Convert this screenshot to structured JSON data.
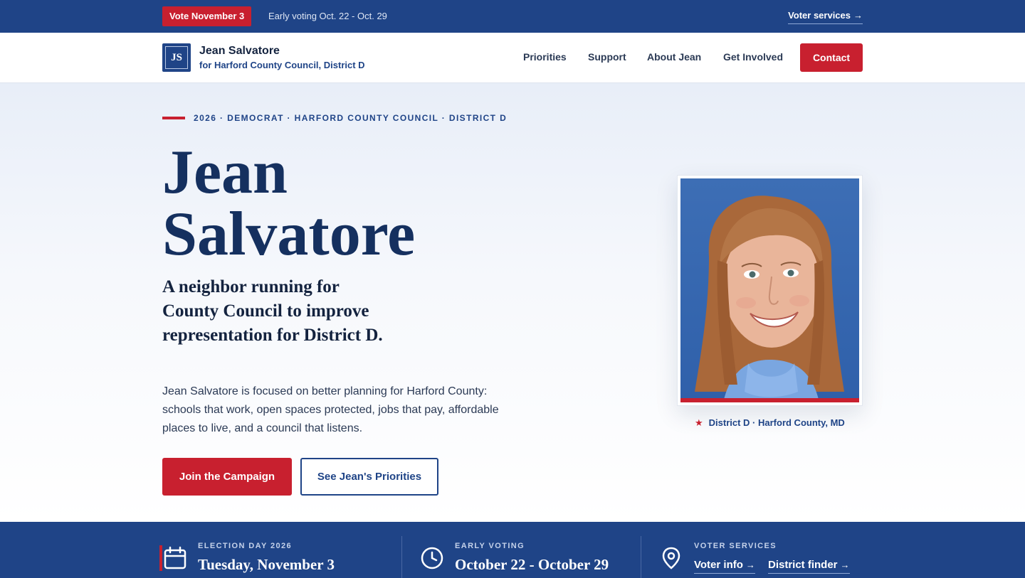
{
  "topbar": {
    "vote_badge": "Vote November 3",
    "early_voting": "Early voting Oct. 22 - Oct. 29",
    "voter_services": "Voter services",
    "arrow": "→"
  },
  "header": {
    "logo_initials": "JS",
    "brand_name": "Jean Salvatore",
    "brand_sub": "for Harford County Council, District D",
    "nav": [
      "Priorities",
      "Support",
      "About Jean",
      "Get Involved"
    ],
    "contact": "Contact"
  },
  "hero": {
    "eyebrow": "2026 · DEMOCRAT · HARFORD COUNTY COUNCIL · DISTRICT D",
    "name_first": "Jean",
    "name_last": "Salvatore",
    "tagline": "A neighbor running for County Council to improve representation for District D.",
    "intro": "Jean Salvatore is focused on better planning for Harford County: schools that work, open spaces protected, jobs that pay, affordable places to live, and a council that listens.",
    "join_button": "Join the Campaign",
    "priorities_button": "See Jean's Priorities",
    "photo_caption": "District D · Harford County, MD",
    "caption_star": "★"
  },
  "band": {
    "election_label": "ELECTION DAY 2026",
    "election_value": "Tuesday, November 3",
    "early_label": "EARLY VOTING",
    "early_value": "October 22 - October 29",
    "services_label": "VOTER SERVICES",
    "voter_info": "Voter info",
    "district_finder": "District finder",
    "arrow": "→"
  },
  "colors": {
    "navy": "#1f4487",
    "red": "#c8202f",
    "ink": "#14233f"
  },
  "icons": [
    "calendar-icon",
    "clock-icon",
    "map-pin-icon",
    "star-icon"
  ]
}
